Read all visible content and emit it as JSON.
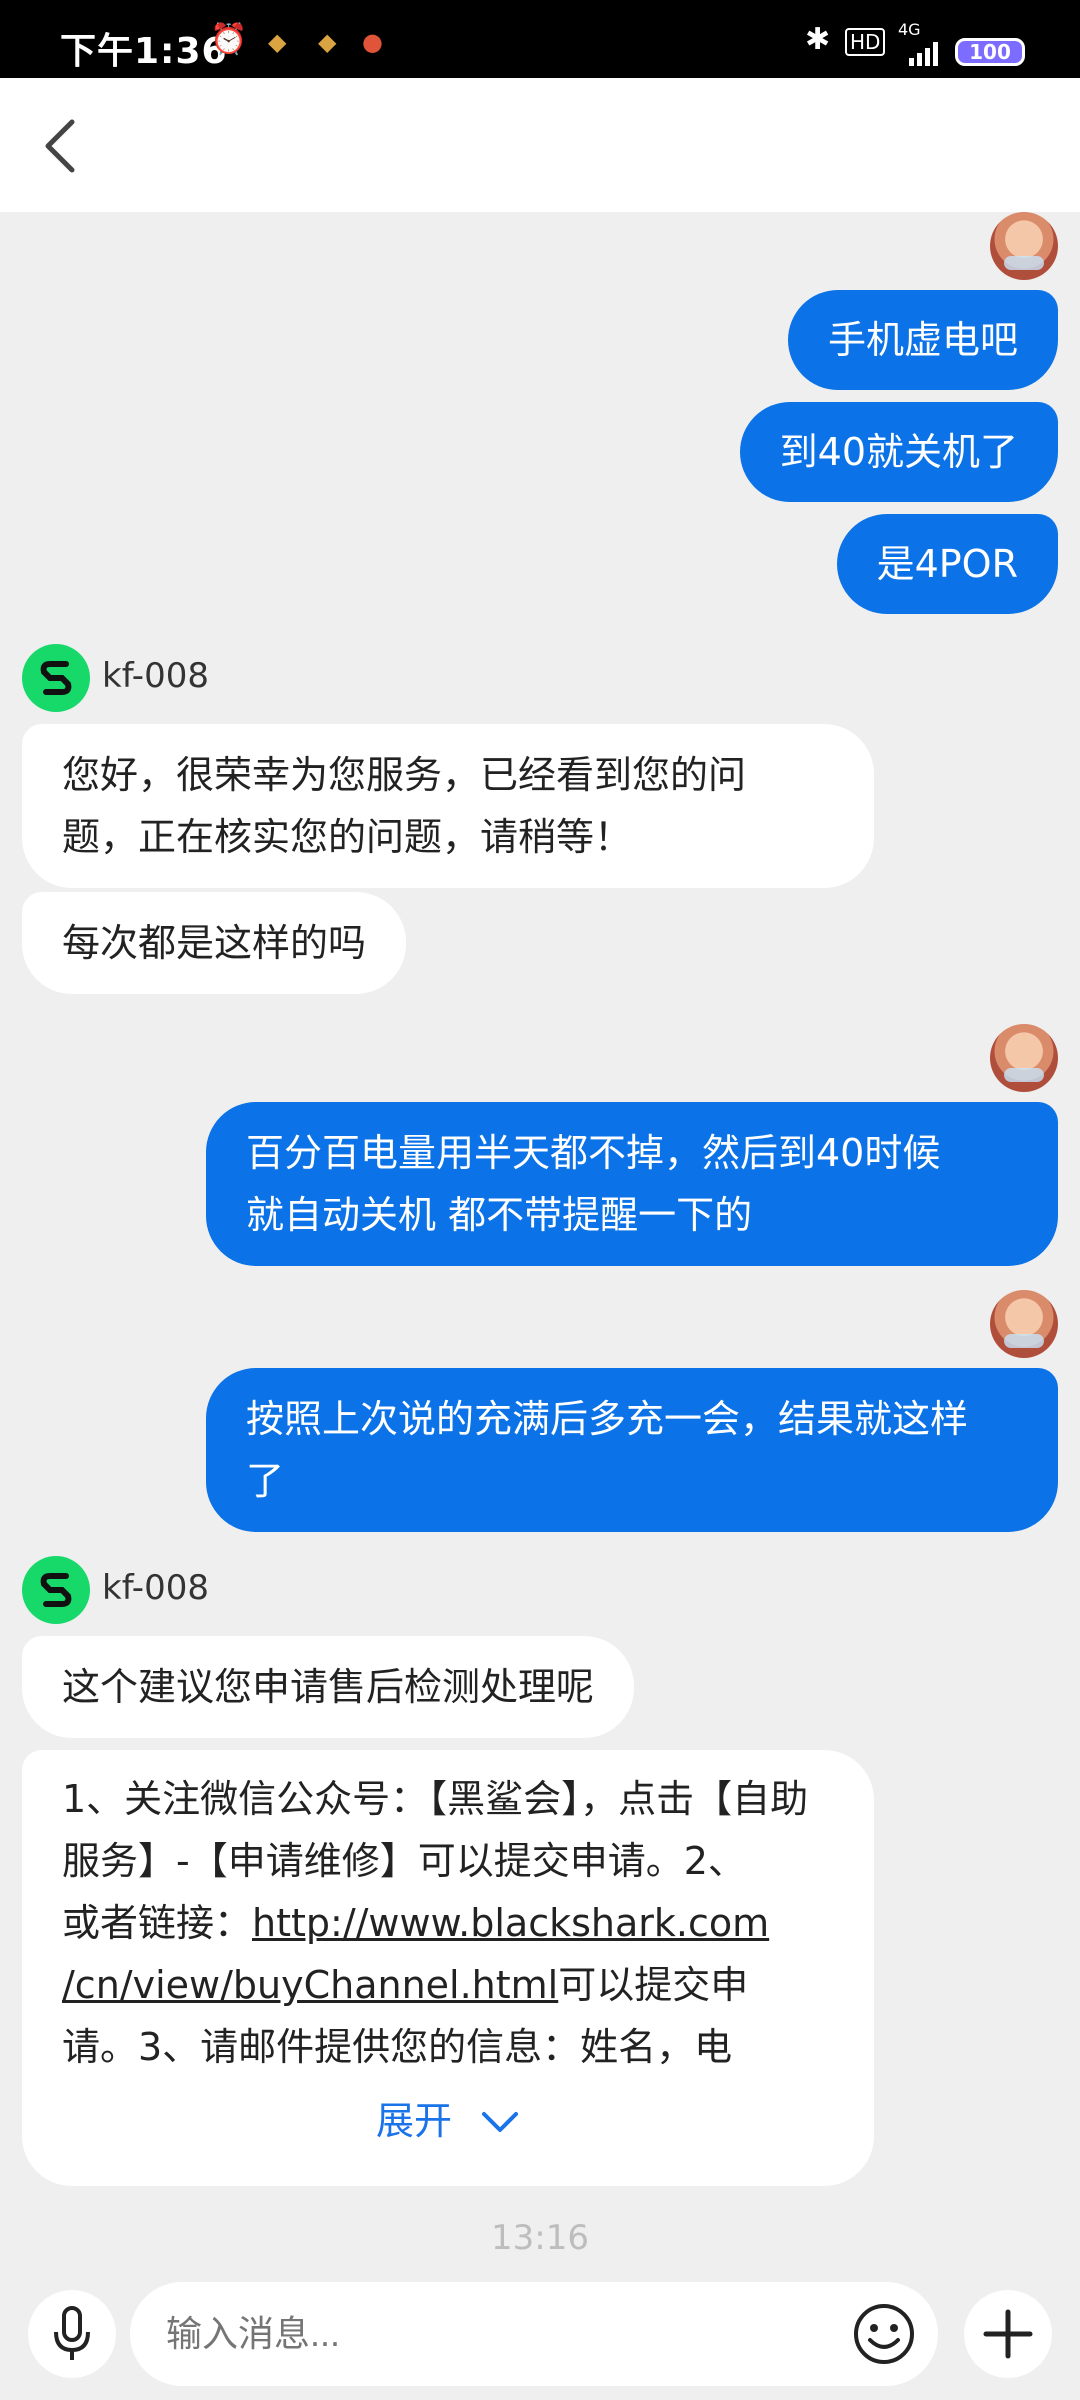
{
  "status_bar": {
    "time": "下午1:36",
    "network": "4G",
    "hd": "HD",
    "battery": "100"
  },
  "messages": {
    "r1": "手机虚电吧",
    "r2": "到40就关机了",
    "r3": "是4POR",
    "agent_name": "kf-008",
    "l1_line1": "您好，很荣幸为您服务，已经看到您的问",
    "l1_line2": "题，正在核实您的问题，请稍等！",
    "l2": "每次都是这样的吗",
    "r4_line1": "百分百电量用半天都不掉，然后到40时候",
    "r4_line2": "就自动关机 都不带提醒一下的",
    "r5_line1": "按照上次说的充满后多充一会，结果就这样",
    "r5_line2": "了",
    "agent_name2": "kf-008",
    "l3": "这个建议您申请售后检测处理呢",
    "l4_line1": "1、关注微信公众号：【黑鲨会】，点击【自助",
    "l4_line2": "服务】-【申请维修】可以提交申请。2、",
    "l4_line3_prefix": "或者链接：",
    "l4_link_part1": "http://www.blackshark.com",
    "l4_link_part2": "/cn/view/buyChannel.html",
    "l4_line4_suffix": "可以提交申",
    "l4_line5": "请。3、请邮件提供您的信息：姓名，电",
    "expand_label": "展开"
  },
  "timestamp": "13:16",
  "input": {
    "placeholder": "输入消息..."
  },
  "colors": {
    "sent_bubble": "#0b72e7",
    "received_bubble": "#ffffff",
    "agent_avatar": "#16d96a",
    "link_expand": "#1a73e8"
  },
  "icons": [
    "back-arrow-icon",
    "alarm-icon",
    "bluetooth-icon",
    "signal-icon",
    "microphone-icon",
    "emoji-icon",
    "plus-icon",
    "chevron-down-icon"
  ]
}
